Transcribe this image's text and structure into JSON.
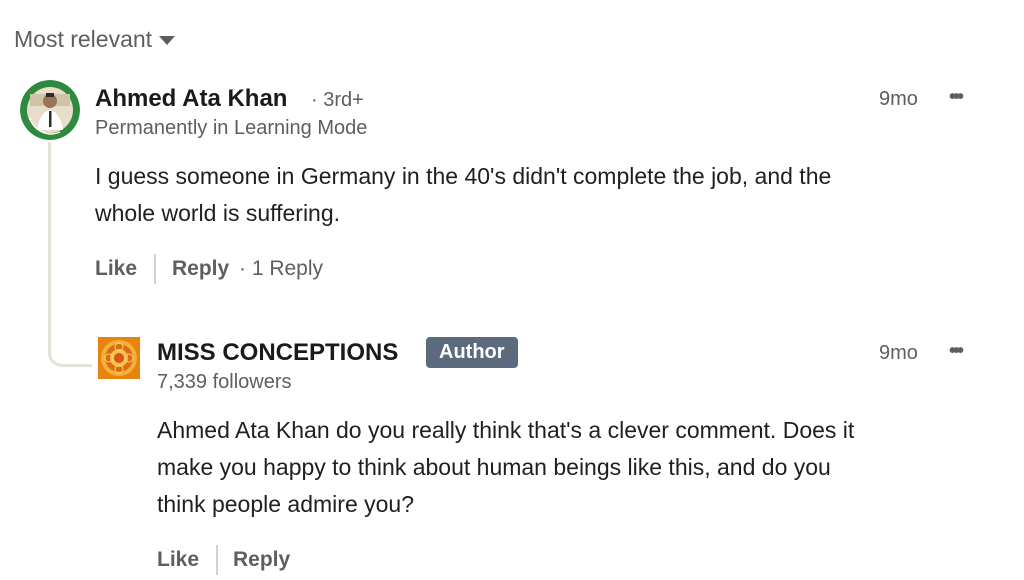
{
  "sort": {
    "label": "Most relevant",
    "icon": "caret-down-icon"
  },
  "comment": {
    "author": "Ahmed Ata Khan",
    "degree": "· 3rd+",
    "headline": "Permanently in Learning Mode",
    "time": "9mo",
    "menu": "•••",
    "text_line1": "I guess someone in Germany in the 40's didn't complete the job, and the",
    "text_line2": "whole world is suffering.",
    "like": "Like",
    "reply": "Reply",
    "reply_count": "· 1 Reply"
  },
  "reply": {
    "author": "MISS CONCEPTIONS",
    "badge": "Author",
    "followers": "7,339 followers",
    "time": "9mo",
    "menu": "•••",
    "text_line1": "Ahmed Ata Khan do you really think that's a clever comment. Does it",
    "text_line2": "make you happy to think about human beings like this, and do you",
    "text_line3": "think people admire you?",
    "like": "Like",
    "reply": "Reply"
  }
}
